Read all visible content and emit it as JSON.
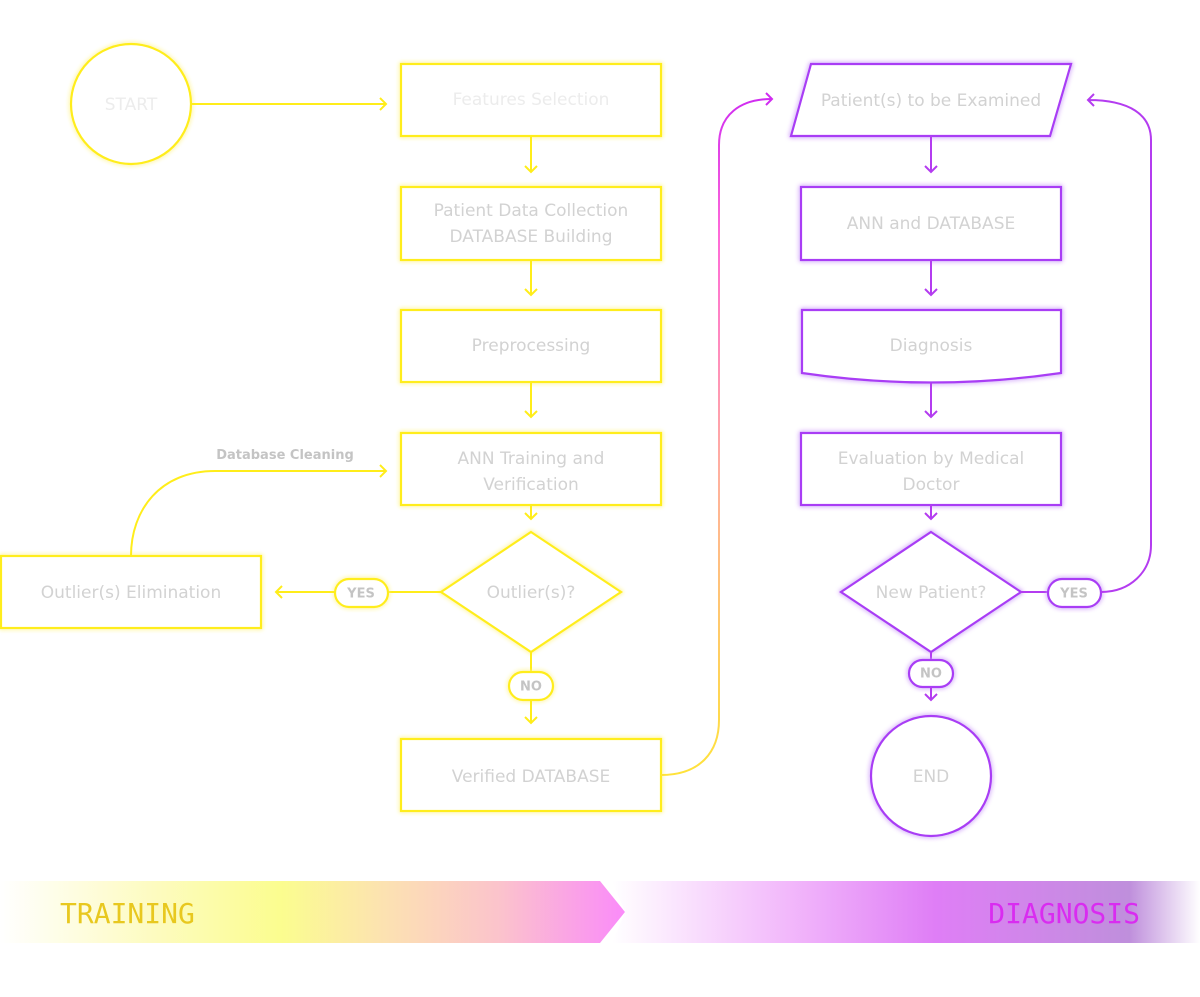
{
  "diagram": {
    "colors": {
      "training": "#ffed1a",
      "diagnosis": "#b43cf0",
      "node_text": "#d2d2d2",
      "training_label": "#e8c81f",
      "diagnosis_label": "#d92cf0"
    },
    "training": {
      "start": "START",
      "features_selection": "Features Selection",
      "data_collection_line1": "Patient Data Collection",
      "data_collection_line2": "DATABASE Building",
      "preprocessing": "Preprocessing",
      "ann_training_line1": "ANN Training and",
      "ann_training_line2": "Verification",
      "outliers_decision": "Outlier(s)?",
      "outliers_elimination": "Outlier(s) Elimination",
      "database_cleaning": "Database Cleaning",
      "yes": "YES",
      "no": "NO",
      "verified_database": "Verified DATABASE"
    },
    "diagnosis": {
      "patients_input": "Patient(s) to be Examined",
      "ann_database": "ANN and DATABASE",
      "diagnosis": "Diagnosis",
      "evaluation_line1": "Evaluation by Medical",
      "evaluation_line2": "Doctor",
      "new_patient_decision": "New Patient?",
      "yes": "YES",
      "no": "NO",
      "end": "END"
    }
  },
  "phase_band": {
    "training_label": "TRAINING",
    "diagnosis_label": "DIAGNOSIS"
  }
}
